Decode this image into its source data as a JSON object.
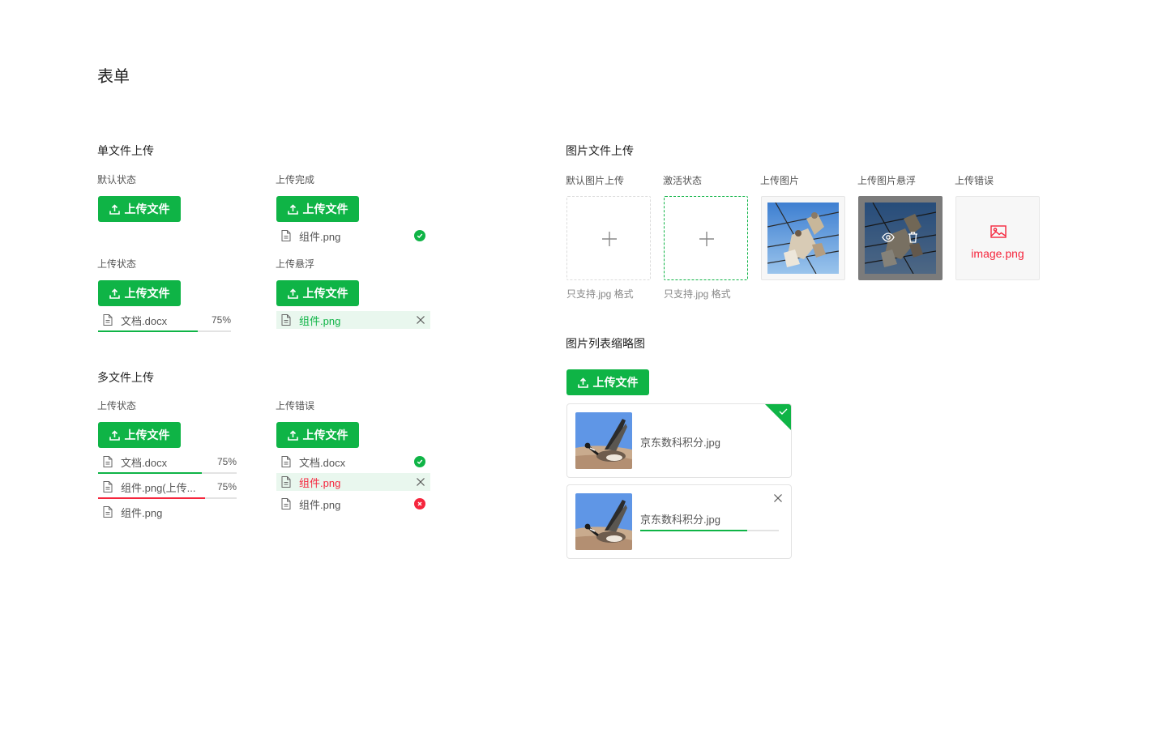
{
  "page": {
    "title": "表单"
  },
  "colors": {
    "accent": "#0fb446",
    "error": "#f5263d",
    "hover_bg": "#e9f7ee"
  },
  "single_upload": {
    "title": "单文件上传",
    "default": {
      "label": "默认状态",
      "button": "上传文件"
    },
    "done": {
      "label": "上传完成",
      "button": "上传文件",
      "file": {
        "name": "组件.png",
        "status": "success"
      }
    },
    "uploading": {
      "label": "上传状态",
      "button": "上传文件",
      "file": {
        "name": "文档.docx",
        "percent_text": "75%",
        "progress": 0.75
      }
    },
    "hover": {
      "label": "上传悬浮",
      "button": "上传文件",
      "file": {
        "name": "组件.png",
        "action": "close-icon"
      }
    }
  },
  "multi_upload": {
    "title": "多文件上传",
    "uploading": {
      "label": "上传状态",
      "button": "上传文件",
      "files": [
        {
          "name": "文档.docx",
          "percent_text": "75%",
          "progress": 0.75,
          "color": "#0fb446"
        },
        {
          "name": "组件.png(上传...",
          "percent_text": "75%",
          "progress": 0.75,
          "color": "#f5263d"
        },
        {
          "name": "组件.png"
        }
      ]
    },
    "error": {
      "label": "上传错误",
      "button": "上传文件",
      "files": [
        {
          "name": "文档.docx",
          "status": "success"
        },
        {
          "name": "组件.png",
          "status": "hover-error",
          "action": "close-icon"
        },
        {
          "name": "组件.png",
          "status": "error"
        }
      ]
    }
  },
  "image_upload": {
    "title": "图片文件上传",
    "items": [
      {
        "label": "默认图片上传",
        "hint": "只支持.jpg 格式"
      },
      {
        "label": "激活状态",
        "hint": "只支持.jpg 格式"
      },
      {
        "label": "上传图片"
      },
      {
        "label": "上传图片悬浮",
        "actions": [
          "eye-icon",
          "trash-icon"
        ]
      },
      {
        "label": "上传错误",
        "error_text": "image.png"
      }
    ]
  },
  "thumbnail_list": {
    "title": "图片列表缩略图",
    "button": "上传文件",
    "cards": [
      {
        "name": "京东数科积分.jpg",
        "status": "success"
      },
      {
        "name": "京东数科积分.jpg",
        "progress": 0.76,
        "action": "close-icon"
      }
    ]
  }
}
